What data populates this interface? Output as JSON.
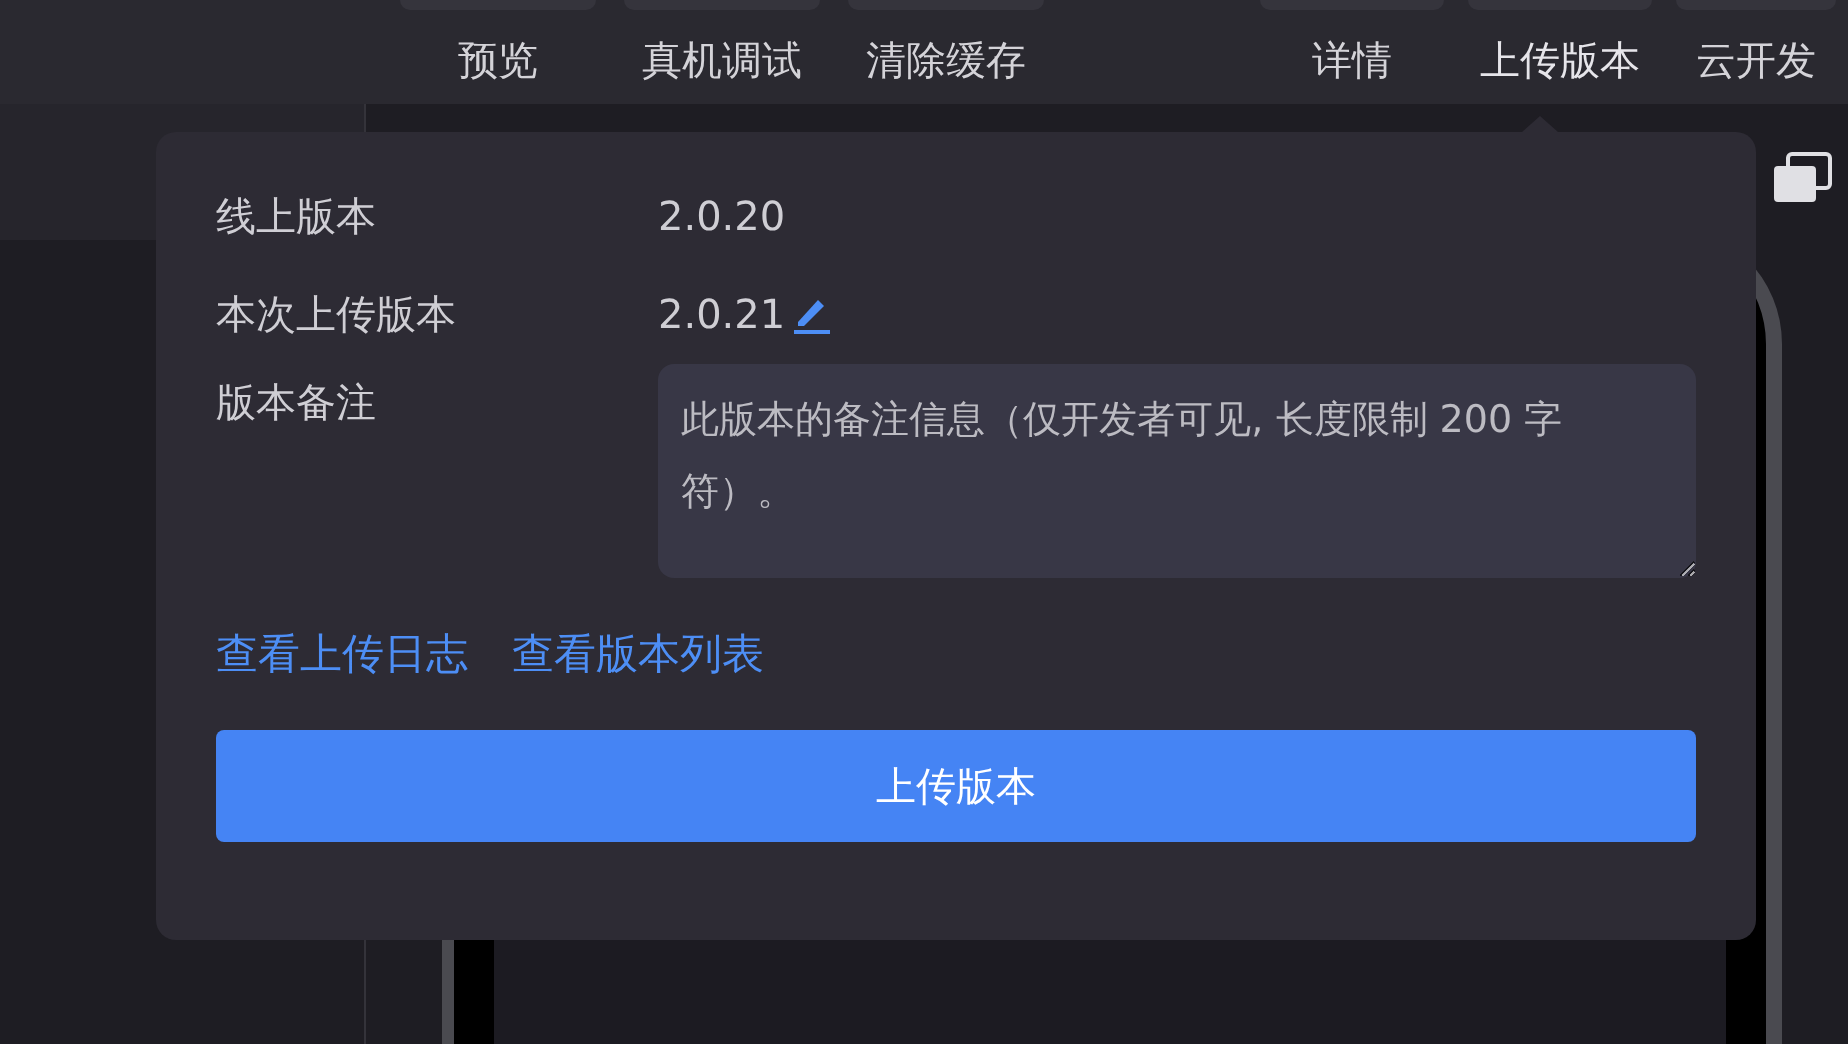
{
  "toolbar": {
    "left_items": [
      {
        "label": "预览"
      },
      {
        "label": "真机调试"
      },
      {
        "label": "清除缓存"
      }
    ],
    "right_items": [
      {
        "label": "详情",
        "selected": false
      },
      {
        "label": "上传版本",
        "selected": true
      },
      {
        "label": "云开发",
        "selected": false
      }
    ]
  },
  "upload_popover": {
    "online_version_label": "线上版本",
    "online_version": "2.0.20",
    "upload_version_label": "本次上传版本",
    "upload_version": "2.0.21",
    "note_label": "版本备注",
    "note": {
      "placeholder": "此版本的备注信息（仅开发者可见, 长度限制 200 字符）。"
    },
    "links": [
      "查看上传日志",
      "查看版本列表"
    ],
    "submit_button": "上传版本"
  }
}
